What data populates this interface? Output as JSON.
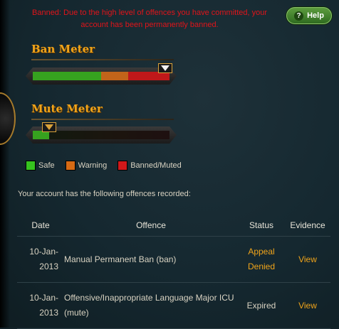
{
  "ban_message": "Banned: Due to the high level of offences you have committed, your account has been permanently banned.",
  "help_button": "Help",
  "help_icon": "?",
  "ban_meter": {
    "title": "Ban Meter",
    "level": 0.97,
    "segments": [
      {
        "state": "safe",
        "share": 0.5,
        "color": "#36a21f"
      },
      {
        "state": "warning",
        "share": 0.2,
        "color": "#c2641a"
      },
      {
        "state": "banned",
        "share": 0.3,
        "color": "#c0181a"
      }
    ]
  },
  "mute_meter": {
    "title": "Mute Meter",
    "level": 0.12
  },
  "legend": [
    {
      "label": "Safe",
      "color": "#36c21f"
    },
    {
      "label": "Warning",
      "color": "#d66a14"
    },
    {
      "label": "Banned/Muted",
      "color": "#d0181a"
    }
  ],
  "intro_text": "Your account has the following offences recorded:",
  "table": {
    "headers": {
      "date": "Date",
      "offence": "Offence",
      "status": "Status",
      "evidence": "Evidence"
    },
    "rows": [
      {
        "date_line1": "10-Jan-",
        "date_line2": "2013",
        "offence": "Manual Permanent Ban (ban)",
        "status_line1": "Appeal",
        "status_line2": "Denied",
        "evidence": "View"
      },
      {
        "date_line1": "10-Jan-",
        "date_line2": "2013",
        "offence": "Offensive/Inappropriate Language Major ICU (mute)",
        "status_line1": "Expired",
        "status_line2": "",
        "evidence": "View"
      }
    ]
  }
}
